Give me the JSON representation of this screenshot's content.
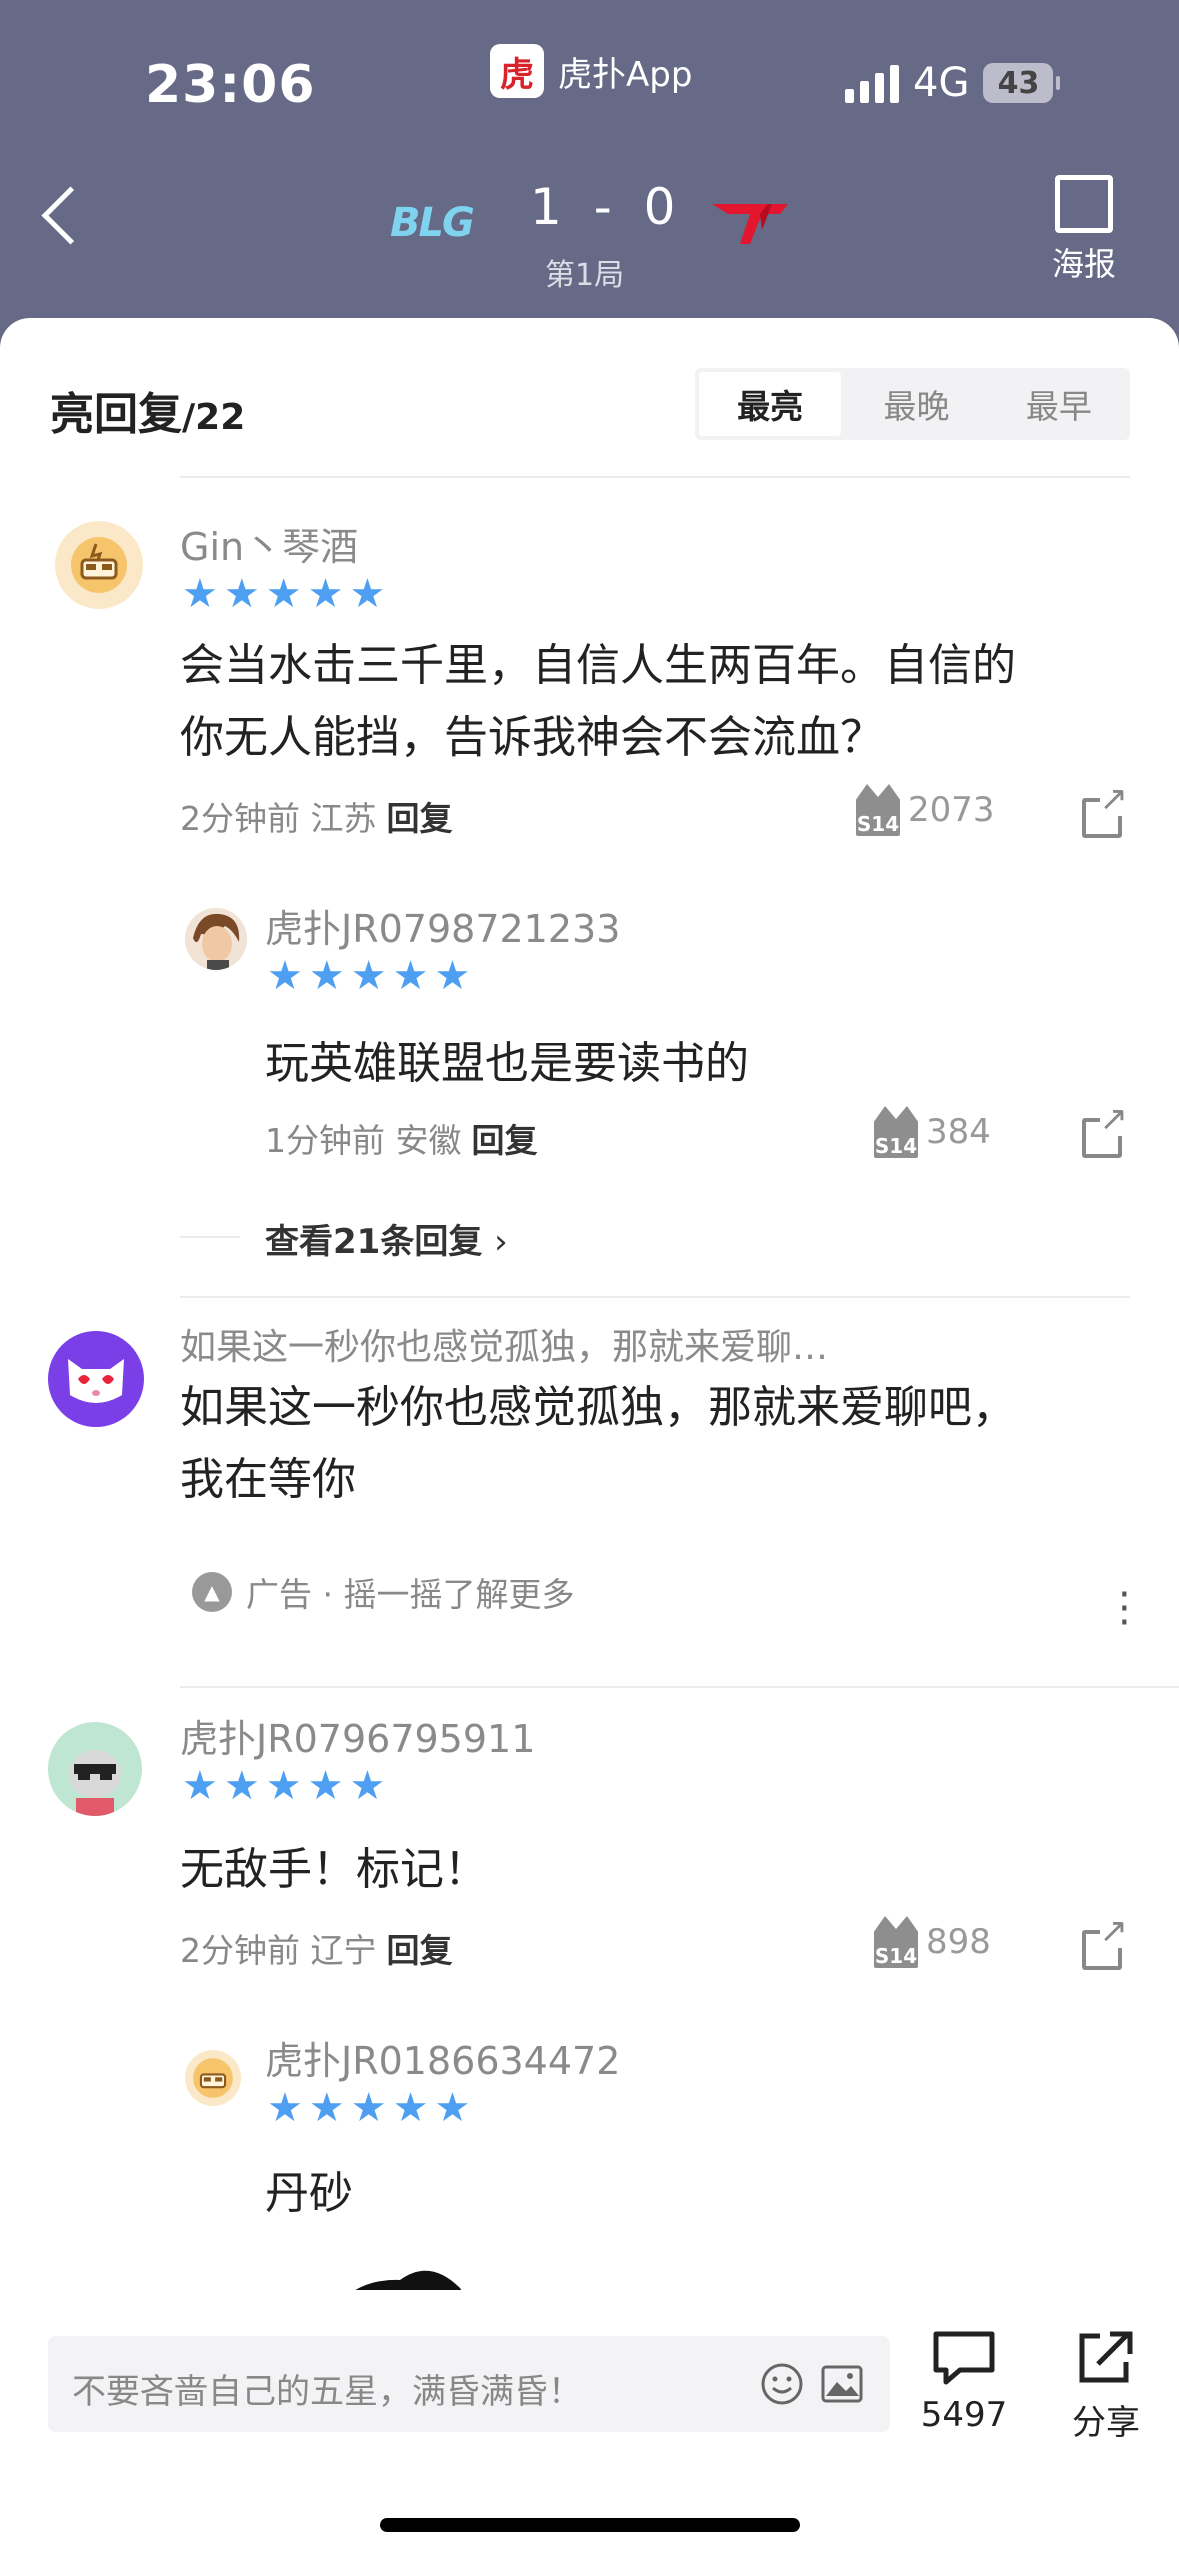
{
  "status_bar": {
    "time": "23:06",
    "app_name": "虎扑App",
    "app_logo_char": "虎",
    "network": "4G",
    "battery": "43"
  },
  "match": {
    "team_left": "BLG",
    "score": "1 - 0",
    "round": "第1局",
    "team_right": "T1",
    "poster_label": "海报"
  },
  "section": {
    "title": "亮回复",
    "count": "/22",
    "sort_tabs": [
      "最亮",
      "最晚",
      "最早"
    ]
  },
  "comments": [
    {
      "user": "Gin丶琴酒",
      "content_line1": "会当水击三千里，自信人生两百年。自信的",
      "content_line2": "你无人能挡，告诉我神会不会流血？",
      "time": "2分钟前",
      "region": "江苏",
      "reply_label": "回复",
      "lights": "2073",
      "reply": {
        "user": "虎扑JR0798721233",
        "content": "玩英雄联盟也是要读书的",
        "time": "1分钟前",
        "region": "安徽",
        "reply_label": "回复",
        "lights": "384"
      },
      "more_replies": "查看21条回复"
    },
    {
      "user": "虎扑JR0796795911",
      "content": "无敌手！标记！",
      "time": "2分钟前",
      "region": "辽宁",
      "reply_label": "回复",
      "lights": "898",
      "reply": {
        "user": "虎扑JR0186634472",
        "content": "丹砂"
      }
    }
  ],
  "ad": {
    "title": "如果这一秒你也感觉孤独，那就来爱聊…",
    "content_line1": "如果这一秒你也感觉孤独，那就来爱聊吧，",
    "content_line2": "我在等你",
    "label": "广告 · 摇一摇了解更多"
  },
  "bottom_bar": {
    "input_placeholder": "不要吝啬自己的五星，满昏满昏！",
    "comment_count": "5497",
    "share_label": "分享"
  },
  "colors": {
    "header_bg": "#676a86",
    "star_blue": "#4e9ff1"
  }
}
